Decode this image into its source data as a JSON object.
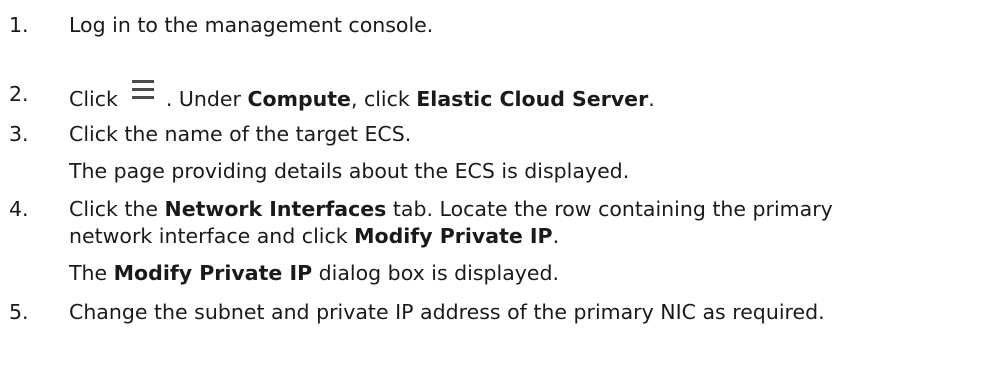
{
  "steps": [
    {
      "number": "1.",
      "text": "Log in to the management console."
    },
    {
      "number": "2.",
      "pre": "Click",
      "icon": "menu-icon",
      "mid": ". Under ",
      "bold1": "Compute",
      "mid2": ", click ",
      "bold2": "Elastic Cloud Server",
      "end": "."
    },
    {
      "number": "3.",
      "text": "Click the name of the target ECS.",
      "result": "The page providing details about the ECS is displayed."
    },
    {
      "number": "4.",
      "pre": "Click the ",
      "bold1": "Network Interfaces",
      "mid": " tab. Locate the row containing the primary",
      "line2_pre": "network interface and click ",
      "bold2": "Modify Private IP",
      "line2_end": ".",
      "result_bold": "Modify Private IP",
      "result_pre": "The ",
      "result_end": " dialog box is displayed."
    },
    {
      "number": "5.",
      "text": "Change the subnet and private IP address of the primary NIC as required."
    }
  ]
}
